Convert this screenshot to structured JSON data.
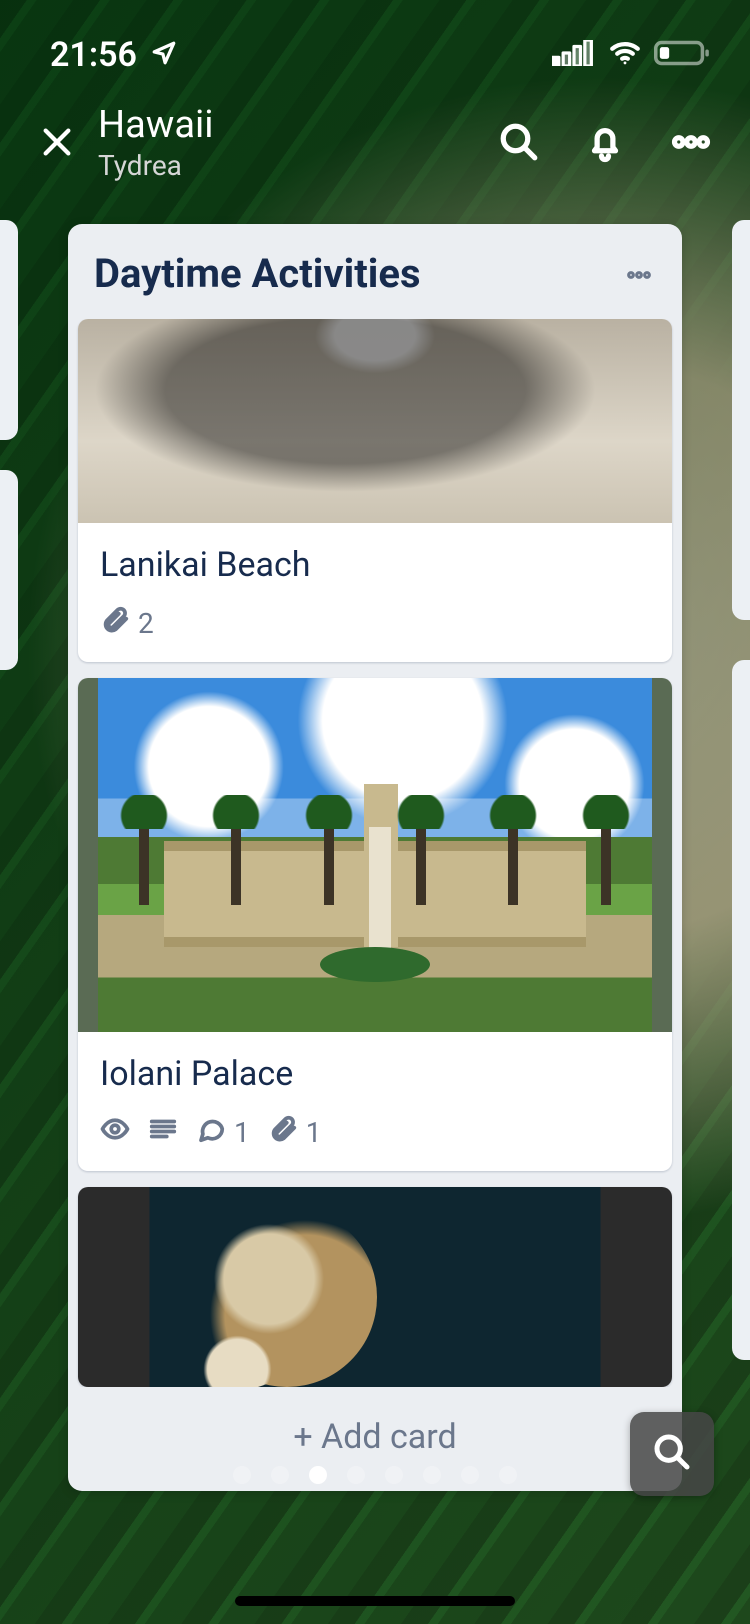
{
  "status": {
    "time": "21:56"
  },
  "header": {
    "board_title": "Hawaii",
    "team_name": "Tydrea"
  },
  "list": {
    "title": "Daytime Activities",
    "add_card_label": "+ Add card",
    "cards": [
      {
        "title": "Lanikai Beach",
        "attachments": "2"
      },
      {
        "title": "Iolani Palace",
        "comments": "1",
        "attachments": "1"
      }
    ]
  },
  "pager": {
    "count": 8,
    "active_index": 2
  }
}
